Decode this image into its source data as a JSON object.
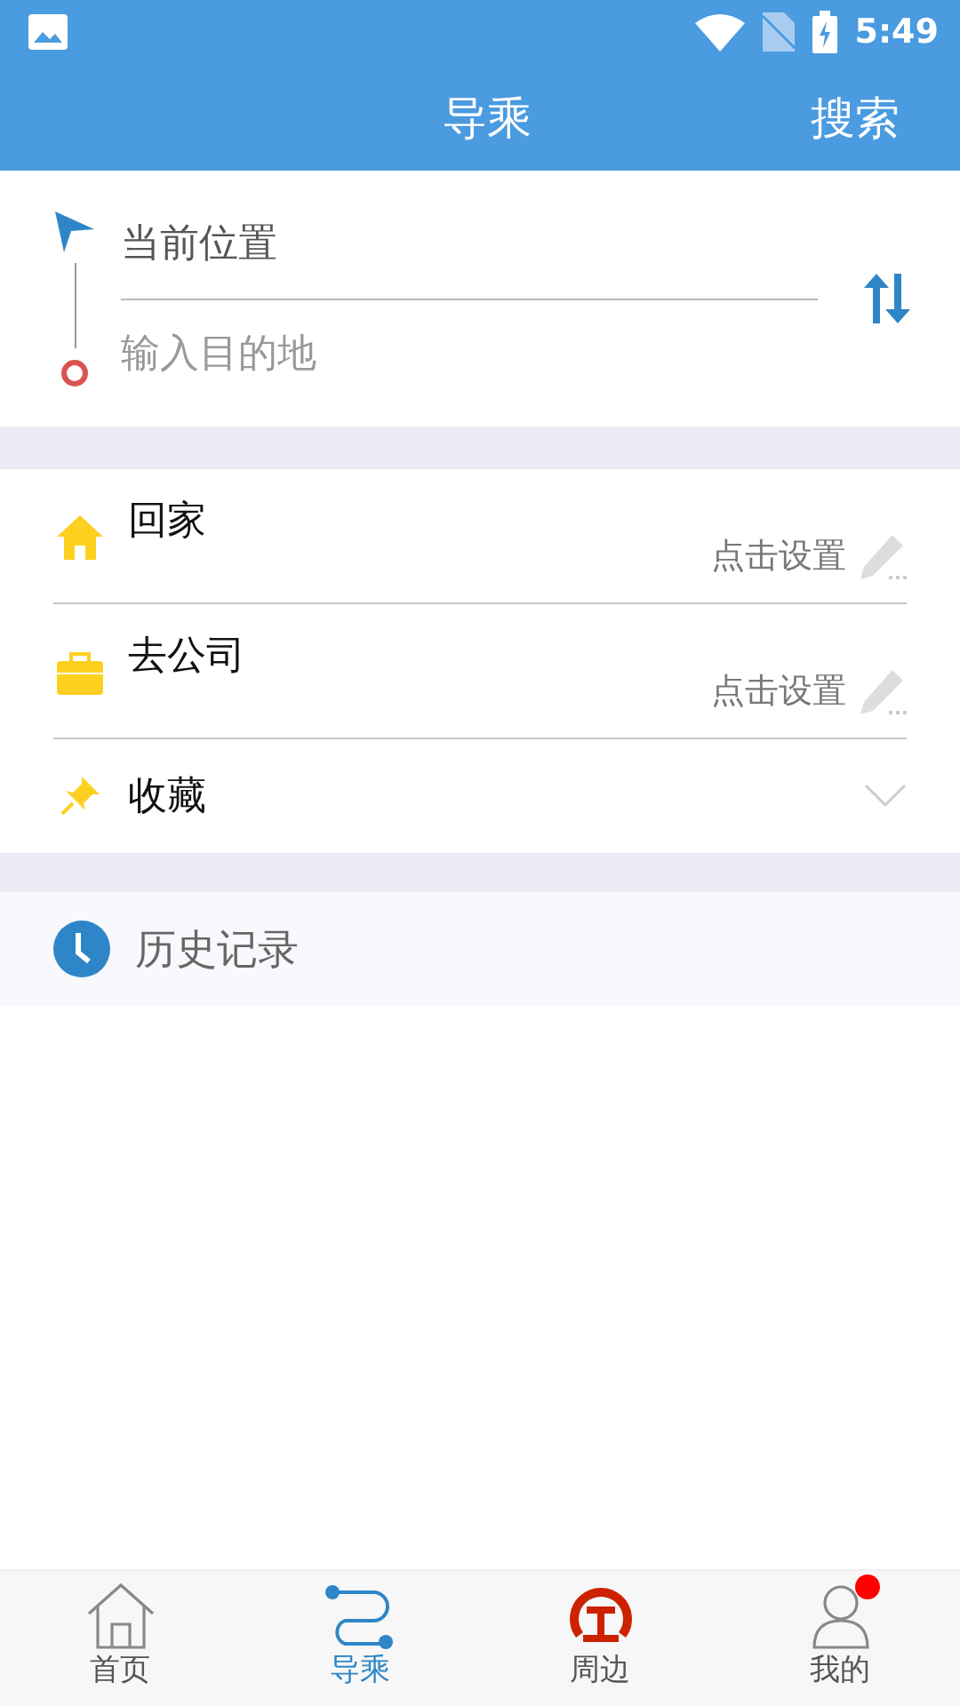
{
  "status_bar": {
    "time": "5:49"
  },
  "header": {
    "title": "导乘",
    "action": "搜索"
  },
  "route": {
    "origin": "当前位置",
    "destination_placeholder": "输入目的地"
  },
  "places": [
    {
      "kind": "home",
      "label": "回家",
      "action": "点击设置"
    },
    {
      "kind": "work",
      "label": "去公司",
      "action": "点击设置"
    },
    {
      "kind": "favorites",
      "label": "收藏"
    }
  ],
  "history": {
    "label": "历史记录"
  },
  "tabs": [
    {
      "kind": "home",
      "label": "首页",
      "selected": false,
      "notification": false
    },
    {
      "kind": "route",
      "label": "导乘",
      "selected": true,
      "notification": false
    },
    {
      "kind": "rail",
      "label": "周边",
      "selected": false,
      "notification": false
    },
    {
      "kind": "user",
      "label": "我的",
      "selected": false,
      "notification": true
    }
  ]
}
